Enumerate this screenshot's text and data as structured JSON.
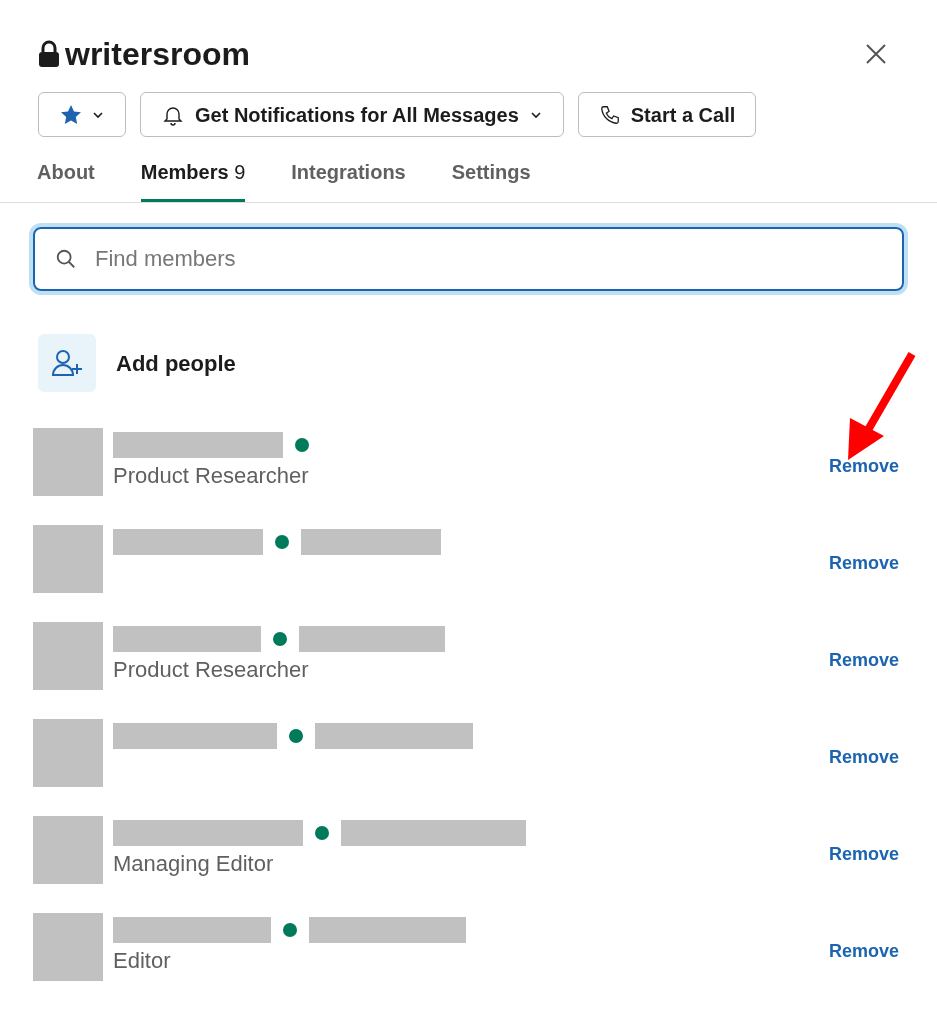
{
  "channel": {
    "name": "writersroom",
    "private": true
  },
  "actions": [
    {
      "kind": "star"
    },
    {
      "kind": "notifications",
      "label": "Get Notifications for All Messages"
    },
    {
      "kind": "call",
      "label": "Start a Call"
    }
  ],
  "tabs": [
    {
      "label": "About",
      "selected": false
    },
    {
      "label": "Members",
      "count": "9",
      "selected": true
    },
    {
      "label": "Integrations",
      "selected": false
    },
    {
      "label": "Settings",
      "selected": false
    }
  ],
  "search": {
    "placeholder": "Find members"
  },
  "add_people": {
    "label": "Add people"
  },
  "members": [
    {
      "online": true,
      "name_redacted": true,
      "display_name_redacted": false,
      "title": "Product Researcher",
      "action": "Remove"
    },
    {
      "online": true,
      "name_redacted": true,
      "display_name_redacted": true,
      "action": "Remove"
    },
    {
      "online": true,
      "name_redacted": true,
      "display_name_redacted": true,
      "title": "Product Researcher",
      "action": "Remove"
    },
    {
      "online": true,
      "name_redacted": true,
      "display_name_redacted": true,
      "action": "Remove"
    },
    {
      "online": true,
      "name_redacted": true,
      "display_name_redacted": true,
      "title": "Managing Editor",
      "action": "Remove"
    },
    {
      "online": true,
      "name_redacted": true,
      "display_name_redacted": true,
      "title": "Editor",
      "action": "Remove"
    }
  ]
}
